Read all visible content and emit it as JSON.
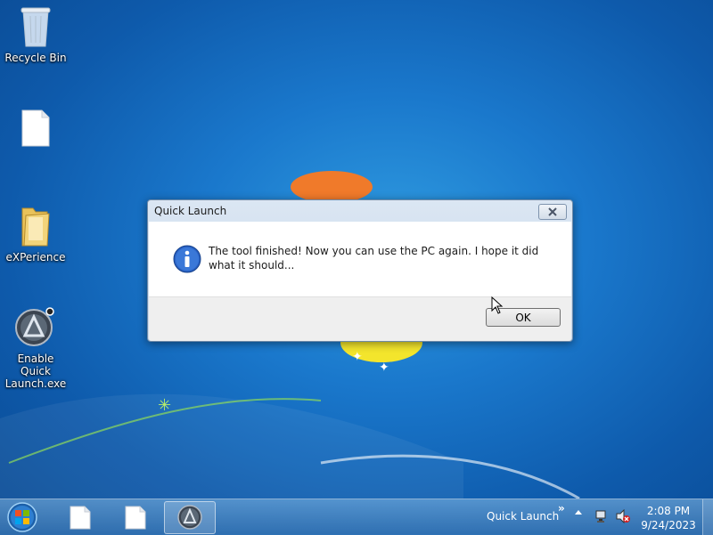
{
  "desktop": {
    "icons": [
      {
        "name": "recycle-bin",
        "label": "Recycle Bin"
      },
      {
        "name": "blank-file",
        "label": ""
      },
      {
        "name": "experience-folder",
        "label": "eXPerience"
      },
      {
        "name": "enable-quick-launch",
        "label": "Enable Quick Launch.exe"
      }
    ]
  },
  "dialog": {
    "title": "Quick Launch",
    "message": "The tool finished! Now you can use the PC again. I hope it did what it should...",
    "ok_label": "OK",
    "icon": "info-icon"
  },
  "taskbar": {
    "buttons": [
      {
        "name": "file",
        "icon": "file-icon"
      },
      {
        "name": "file",
        "icon": "file-icon"
      },
      {
        "name": "quick-launch-app",
        "icon": "aimp-icon",
        "active": true
      }
    ],
    "quick_launch_label": "Quick Launch",
    "quick_launch_chevron": "»",
    "clock": {
      "time": "2:08 PM",
      "date": "9/24/2023"
    }
  },
  "colors": {
    "accent": "#1a78cc",
    "dialog_border": "#6f8aa8"
  }
}
